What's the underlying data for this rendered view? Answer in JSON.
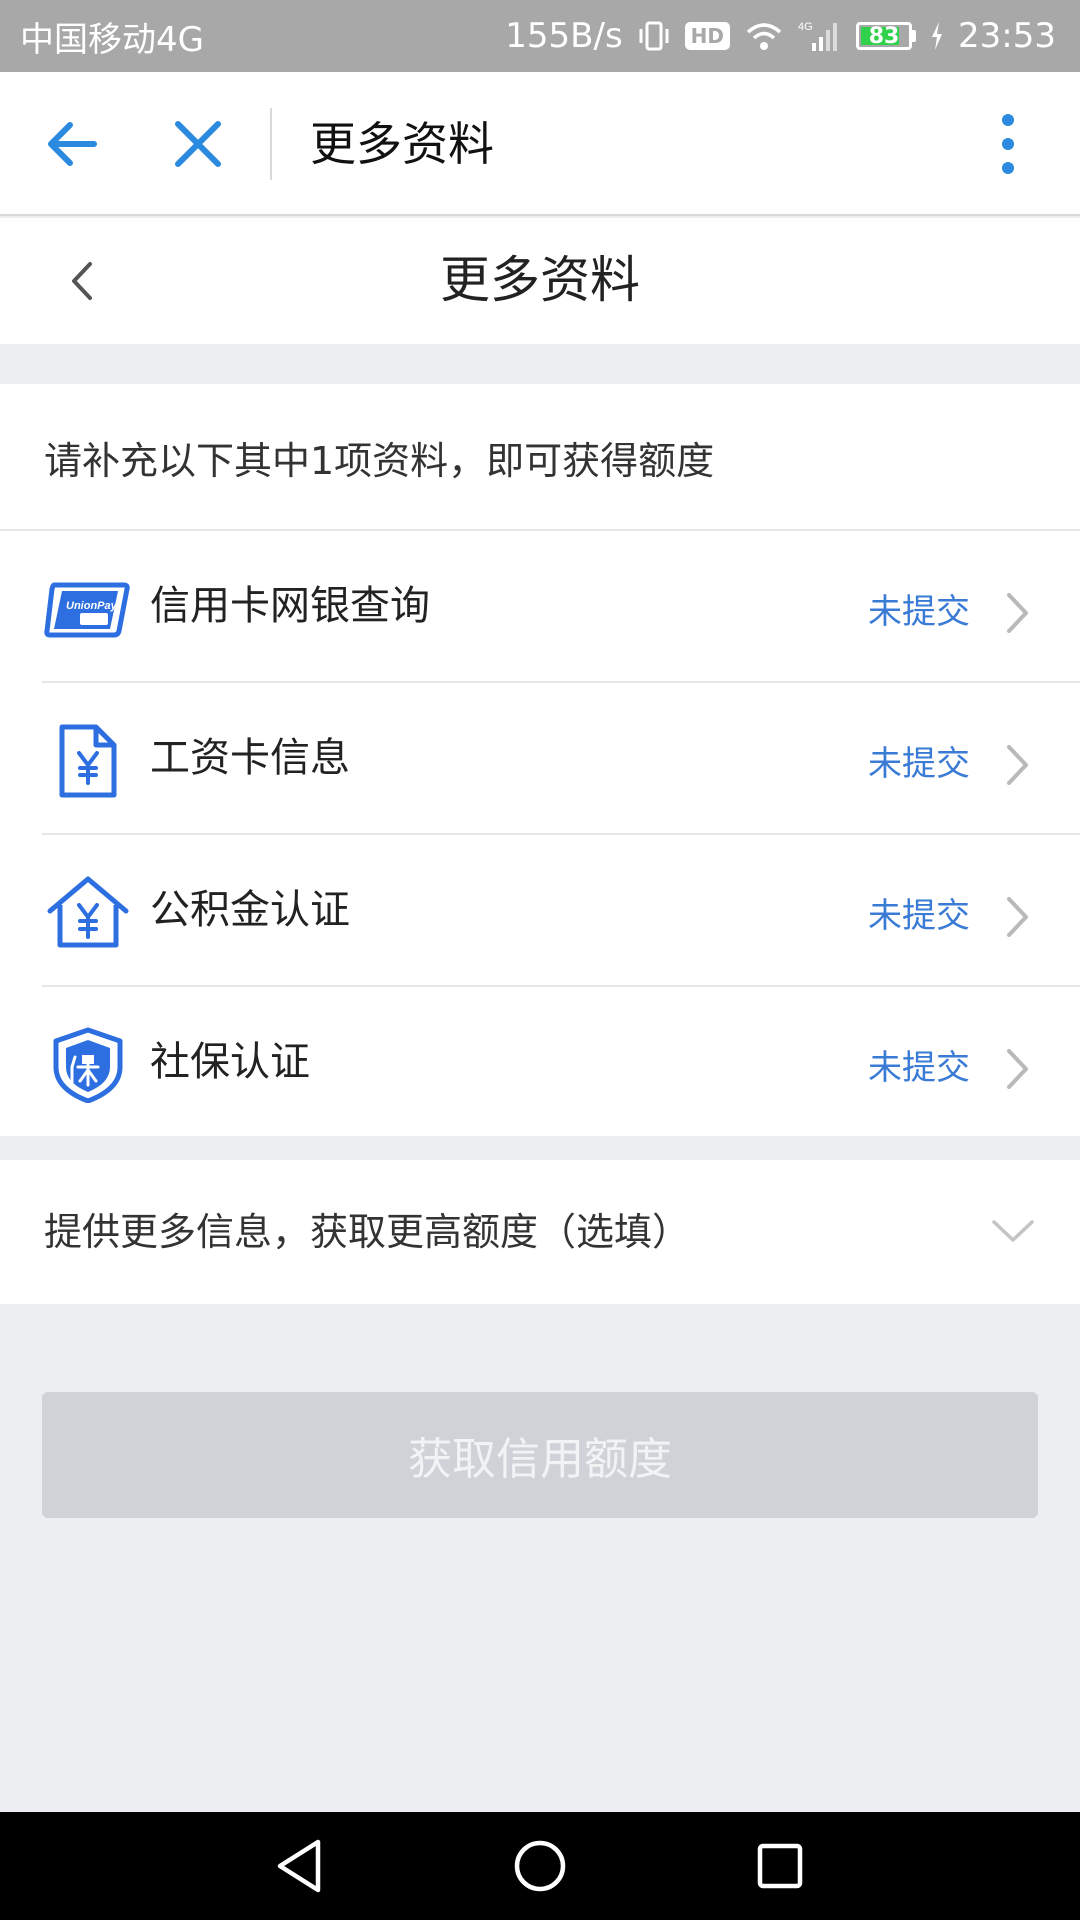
{
  "status_bar": {
    "carrier": "中国移动4G",
    "speed": "155B/s",
    "hd": "HD",
    "network": "4G",
    "battery": "83",
    "battery_level": 0.83,
    "time": "23:53",
    "battery_color": "#2fd24a"
  },
  "toolbar": {
    "back_icon": "arrow-left-icon",
    "close_icon": "close-icon",
    "title": "更多资料",
    "more_icon": "more-vertical-icon",
    "accent": "#2a8ae0"
  },
  "page": {
    "title": "更多资料",
    "back_icon": "chevron-left-icon"
  },
  "section": {
    "hint": "请补充以下其中1项资料，即可获得额度",
    "items": [
      {
        "label": "信用卡网银查询",
        "status": "未提交",
        "icon": "unionpay-card-icon"
      },
      {
        "label": "工资卡信息",
        "status": "未提交",
        "icon": "salary-document-icon"
      },
      {
        "label": "公积金认证",
        "status": "未提交",
        "icon": "housing-fund-icon"
      },
      {
        "label": "社保认证",
        "status": "未提交",
        "icon": "social-security-shield-icon"
      }
    ],
    "status_color": "#3a7bd5"
  },
  "optional": {
    "text": "提供更多信息，获取更高额度（选填）",
    "icon": "chevron-down-icon"
  },
  "submit": {
    "label": "获取信用额度",
    "enabled": false
  },
  "nav": {
    "back_icon": "nav-back-icon",
    "home_icon": "nav-home-icon",
    "recents_icon": "nav-recents-icon"
  }
}
